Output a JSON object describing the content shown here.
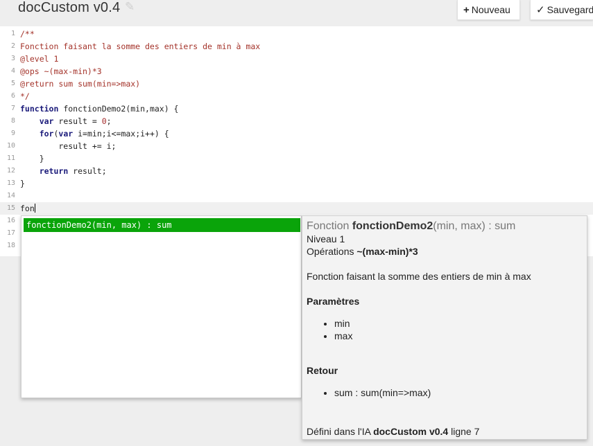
{
  "header": {
    "title": "docCustom v0.4",
    "new_label": "Nouveau",
    "save_label": "Sauvegard"
  },
  "editor": {
    "line_numbers": [
      "1",
      "2",
      "3",
      "4",
      "5",
      "6",
      "7",
      "8",
      "9",
      "10",
      "11",
      "12",
      "13",
      "14",
      "15",
      "16",
      "17",
      "18"
    ],
    "lines": {
      "l1": "/**",
      "l2": "Fonction faisant la somme des entiers de min à max",
      "l3": "@level 1",
      "l4": "@ops ~(max-min)*3",
      "l5": "@return sum sum(min=>max)",
      "l6": "*/",
      "l7_kw": "function",
      "l7_rest": " fonctionDemo2(min,max) {",
      "l8_indent": "    ",
      "l8_kw": "var",
      "l8_mid": " result = ",
      "l8_num": "0",
      "l8_end": ";",
      "l9_indent": "    ",
      "l9_kw1": "for",
      "l9_mid1": "(",
      "l9_kw2": "var",
      "l9_rest": " i=min;i<=max;i++) {",
      "l10": "        result += i;",
      "l11": "    }",
      "l12_indent": "    ",
      "l12_kw": "return",
      "l12_rest": " result;",
      "l13": "}",
      "l15": "fon"
    }
  },
  "autocomplete": {
    "selected_item": "fonctionDemo2(min, max) : sum",
    "selected_color": "#0aa40a"
  },
  "doc": {
    "sig_prefix": "Fonction ",
    "sig_name": "fonctionDemo2",
    "sig_suffix": "(min, max) : sum",
    "level_label": "Niveau ",
    "level_value": "1",
    "ops_label": "Opérations ",
    "ops_value": "~(max-min)*3",
    "description": "Fonction faisant la somme des entiers de min à max",
    "params_title": "Paramètres",
    "params": [
      "min",
      "max"
    ],
    "return_title": "Retour",
    "return_value": "sum : sum(min=>max)",
    "defined_prefix": "Défini dans l'IA ",
    "defined_ai": "docCustom v0.4",
    "defined_line_label": " ligne ",
    "defined_line": "7"
  }
}
